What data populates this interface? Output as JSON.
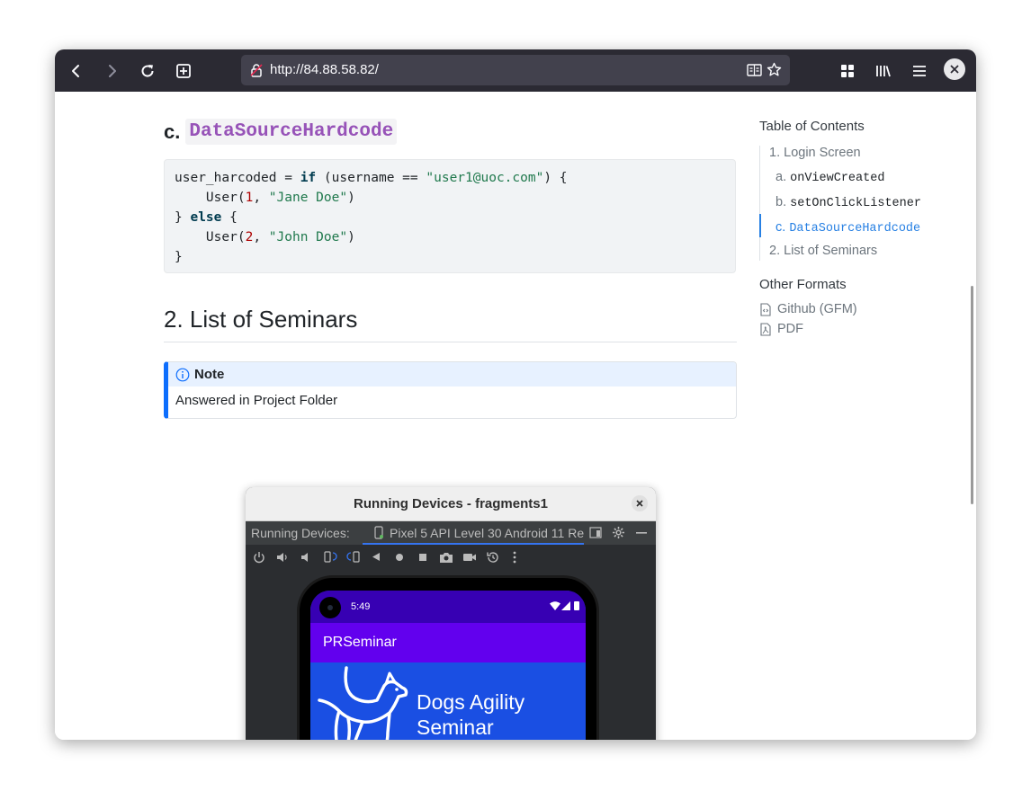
{
  "browser": {
    "url": "http://84.88.58.82/"
  },
  "article": {
    "section_c_prefix": "c.",
    "section_c_code": "DataSourceHardcode",
    "code_lines": [
      "user_harcoded = if (username == \"user1@uoc.com\") {",
      "    User(1, \"Jane Doe\")",
      "} else {",
      "    User(2, \"John Doe\")",
      "}"
    ],
    "section2_title": "2. List of Seminars",
    "note_title": "Note",
    "note_body": "Answered in Project Folder"
  },
  "toc": {
    "title": "Table of Contents",
    "items": [
      {
        "prefix": "1.",
        "label": "Login Screen"
      },
      {
        "prefix": "a.",
        "label": "onViewCreated"
      },
      {
        "prefix": "b.",
        "label": "setOnClickListener"
      },
      {
        "prefix": "c.",
        "label": "DataSourceHardcode"
      },
      {
        "prefix": "2.",
        "label": "List of Seminars"
      }
    ],
    "active_item": "DataSourceHardcode",
    "other_formats_title": "Other Formats",
    "formats": [
      "Github (GFM)",
      "PDF"
    ]
  },
  "dialog": {
    "title": "Running Devices - fragments1",
    "tab_label": "Running Devices:",
    "device_tab": "Pixel 5 API Level 30 Android 11 Re",
    "phone": {
      "time": "5:49",
      "app_title": "PRSeminar",
      "hero_line1": "Dogs Agility",
      "hero_line2": "Seminar"
    }
  },
  "colors": {
    "accent": "#2780e3",
    "note_border": "#0d6efd",
    "code_inline": "#9753b8",
    "app_purple": "#6200ee",
    "status_purple": "#3700b3",
    "hero_blue": "#1a4fe3"
  }
}
